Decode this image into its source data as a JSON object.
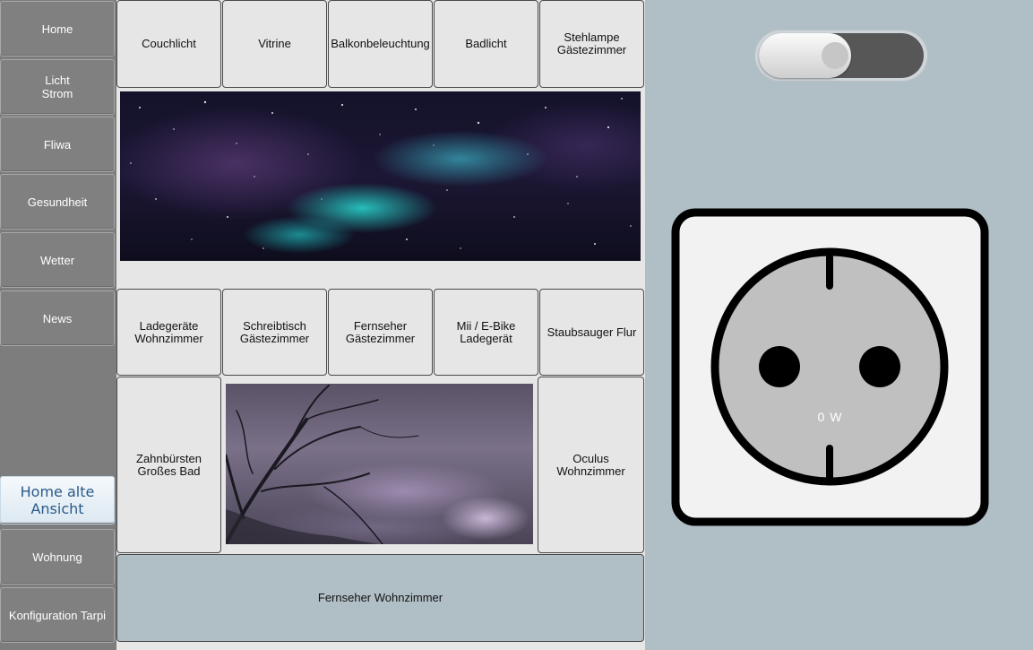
{
  "sidebar": {
    "items": [
      {
        "label": "Home"
      },
      {
        "label": "Licht\nStrom"
      },
      {
        "label": "Fliwa"
      },
      {
        "label": "Gesundheit"
      },
      {
        "label": "Wetter"
      },
      {
        "label": "News"
      },
      {
        "label": "Home alte\nAnsicht"
      },
      {
        "label": "Wohnung"
      },
      {
        "label": "Konfiguration Tarpi"
      }
    ]
  },
  "tiles": {
    "row1": [
      "Couchlicht",
      "Vitrine",
      "Balkonbeleuchtung",
      "Badlicht",
      "Stehlampe\nGästezimmer"
    ],
    "row2": [
      "Ladegeräte\nWohnzimmer",
      "Schreibtisch\nGästezimmer",
      "Fernseher\nGästezimmer",
      "Mii / E-Bike\nLadegerät",
      "Staubsauger Flur"
    ],
    "left": "Zahnbürsten\nGroßes Bad",
    "right": "Oculus\nWohnzimmer",
    "bottom": "Fernseher Wohnzimmer"
  },
  "images": {
    "top": "aurora-night-sky-image",
    "middle": "storm-clouds-branches-image"
  },
  "toggle": {
    "state": "off"
  },
  "socket": {
    "power": "0 W",
    "icon": "power-socket-icon"
  }
}
